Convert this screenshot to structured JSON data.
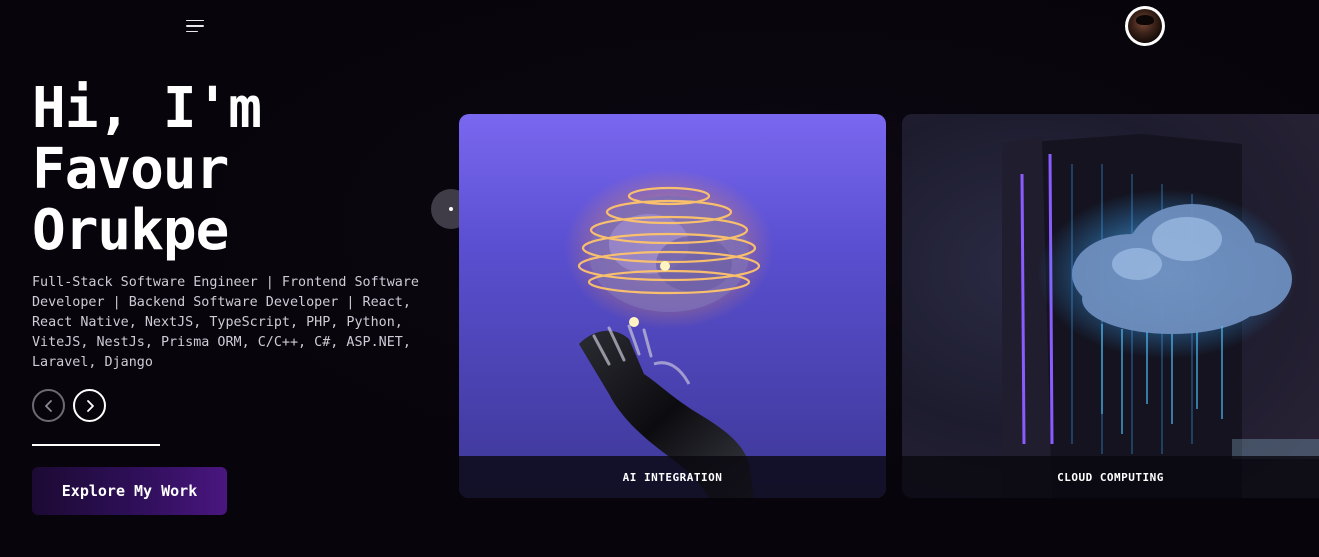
{
  "header": {
    "menu_icon": "hamburger-menu-icon",
    "avatar_icon": "profile-avatar"
  },
  "hero": {
    "title_line1": "Hi, I'm",
    "title_line2": "Favour",
    "title_line3": "Orukpe",
    "description": "Full-Stack Software Engineer | Frontend Software Developer | Backend Software Developer | React, React Native, NextJS, TypeScript, PHP, Python, ViteJS, NestJs, Prisma ORM, C/C++, C#, ASP.NET, Laravel, Django",
    "prev_icon": "chevron-left-icon",
    "next_icon": "chevron-right-icon",
    "cta_label": "Explore My Work"
  },
  "cards": [
    {
      "label": "AI INTEGRATION"
    },
    {
      "label": "CLOUD COMPUTING"
    }
  ],
  "colors": {
    "background": "#07040b",
    "accent": "#4a1680",
    "ai_card": "#6a5ce6"
  }
}
